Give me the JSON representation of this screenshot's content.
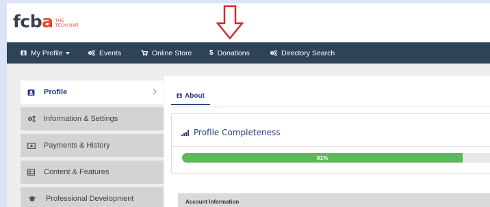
{
  "logo": {
    "word_dark": "fcb",
    "word_red": "a",
    "tag_line1": "THE",
    "tag_line2": "TECH BAR"
  },
  "nav": {
    "items": [
      {
        "label": "My Profile",
        "icon": "user-icon"
      },
      {
        "label": "Events",
        "icon": "cogs-icon"
      },
      {
        "label": "Online Store",
        "icon": "cart-icon"
      },
      {
        "label": "Donations",
        "icon": "dollar-icon"
      },
      {
        "label": "Directory Search",
        "icon": "cogs-icon"
      }
    ]
  },
  "sidebar": {
    "items": [
      {
        "label": "Profile",
        "icon": "user-icon",
        "active": true
      },
      {
        "label": "Information & Settings",
        "icon": "cogs-icon"
      },
      {
        "label": "Payments & History",
        "icon": "money-icon"
      },
      {
        "label": "Content & Features",
        "icon": "table-icon"
      },
      {
        "label": "Professional Development",
        "icon": "graduation-cap-icon"
      }
    ]
  },
  "main": {
    "tab_label": "About",
    "card_title": "Profile Completeness",
    "progress": {
      "value": 0.91,
      "label": "91%"
    },
    "account_header": "Account Information"
  },
  "colors": {
    "nav_bg": "#2f4356",
    "accent": "#233b7a",
    "progress": "#5cb85c",
    "brand_red": "#e8452c",
    "annotation_arrow": "#d9262b"
  }
}
